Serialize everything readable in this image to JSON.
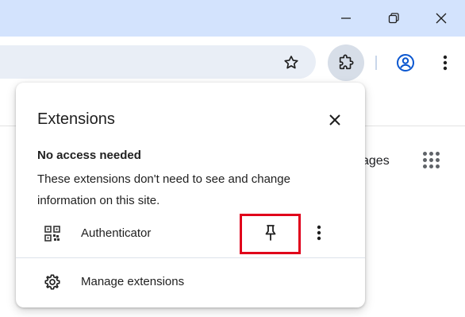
{
  "window": {
    "buttons": [
      {
        "name": "minimize-button",
        "icon": "minimize-icon"
      },
      {
        "name": "restore-button",
        "icon": "restore-icon"
      },
      {
        "name": "close-button",
        "icon": "close-icon"
      }
    ]
  },
  "toolbar": {
    "bookmark_icon": "star-icon",
    "extensions_icon": "puzzle-icon",
    "profile_icon": "account-icon",
    "menu_icon": "kebab-menu-icon",
    "accent_color": "#0b57d0"
  },
  "page": {
    "images_link": "ages"
  },
  "extensions_popup": {
    "title": "Extensions",
    "section_heading": "No access needed",
    "section_description": "These extensions don't need to see and change information on this site.",
    "extensions": [
      {
        "name": "Authenticator",
        "icon": "qr-code-icon",
        "pin_icon": "pin-icon",
        "more_icon": "more-vert-icon",
        "pin_highlight_color": "#e0001b"
      }
    ],
    "manage_label": "Manage extensions",
    "manage_icon": "gear-icon"
  }
}
